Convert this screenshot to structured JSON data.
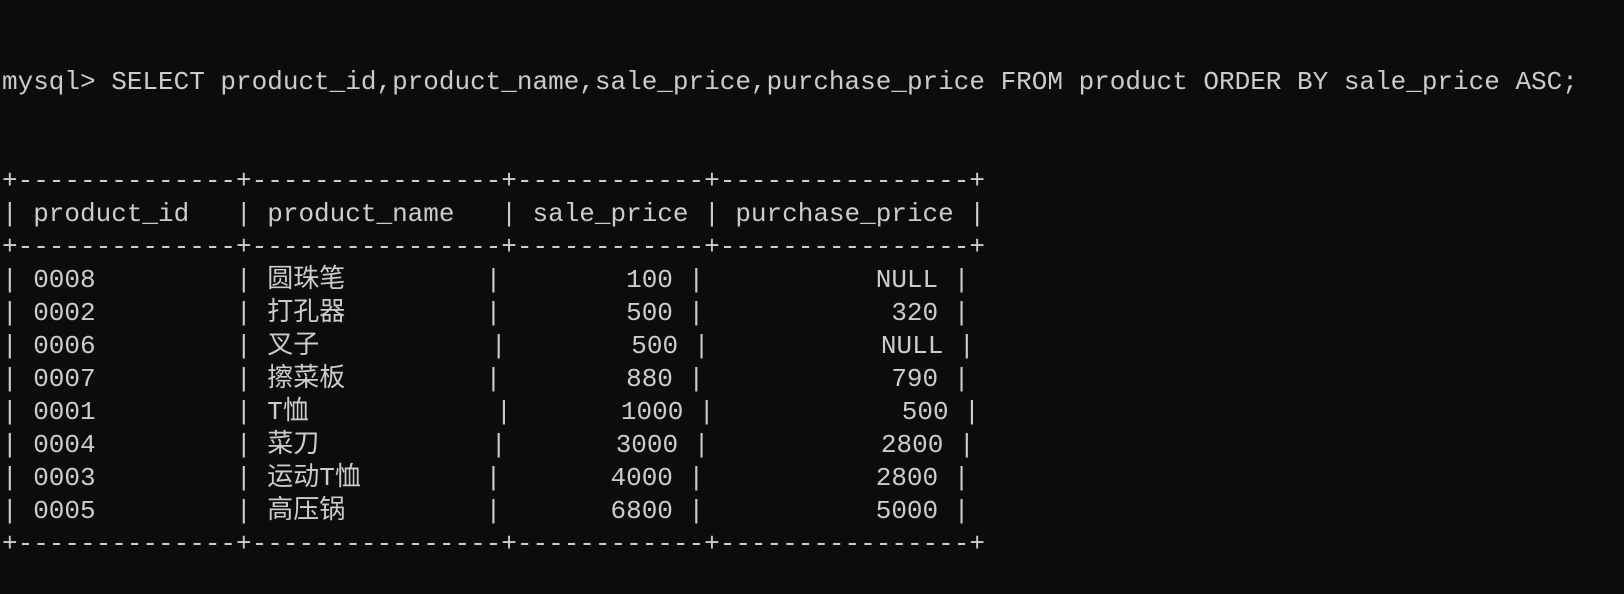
{
  "prompt": "mysql> ",
  "command": "SELECT product_id,product_name,sale_price,purchase_price FROM product ORDER BY sale_price ASC;",
  "table": {
    "columns": [
      {
        "label": "product_id",
        "width": 12,
        "align": "left"
      },
      {
        "label": "product_name",
        "width": 14,
        "align": "left"
      },
      {
        "label": "sale_price",
        "width": 10,
        "align": "right"
      },
      {
        "label": "purchase_price",
        "width": 14,
        "align": "right"
      }
    ],
    "rows": [
      [
        "0008",
        "圆珠笔",
        "100",
        "NULL"
      ],
      [
        "0002",
        "打孔器",
        "500",
        "320"
      ],
      [
        "0006",
        "叉子",
        "500",
        "NULL"
      ],
      [
        "0007",
        "擦菜板",
        "880",
        "790"
      ],
      [
        "0001",
        "T恤",
        "1000",
        "500"
      ],
      [
        "0004",
        "菜刀",
        "3000",
        "2800"
      ],
      [
        "0003",
        "运动T恤",
        "4000",
        "2800"
      ],
      [
        "0005",
        "高压锅",
        "6800",
        "5000"
      ]
    ]
  }
}
